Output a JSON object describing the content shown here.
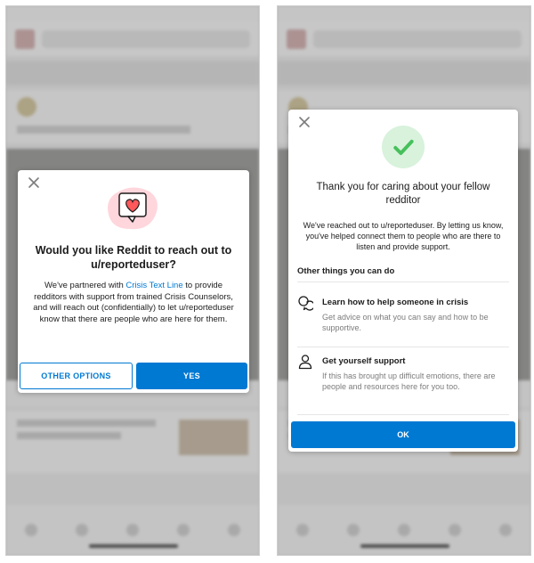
{
  "left_modal": {
    "title": "Would you like Reddit to reach out to u/reporteduser?",
    "body_pre": "We've partnered with ",
    "link_text": "Crisis Text Line",
    "body_post": " to provide redditors with support from trained Crisis Counselors, and will reach out (confidentially) to let u/reporteduser know that there are people who are here for them.",
    "other_options_label": "OTHER OPTIONS",
    "yes_label": "YES"
  },
  "right_modal": {
    "title": "Thank you for caring about your fellow redditor",
    "body": "We've reached out to u/reporteduser. By letting us know, you've helped connect them to people who are there to listen and provide support.",
    "section_heading": "Other things you can do",
    "items": [
      {
        "title": "Learn how to help someone in crisis",
        "desc": "Get advice on what you can say and how to be supportive.",
        "icon": "chat-bubbles-icon"
      },
      {
        "title": "Get yourself support",
        "desc": "If this has brought up difficult emotions, there are people and resources here for you too.",
        "icon": "person-icon"
      }
    ],
    "ok_label": "OK"
  },
  "colors": {
    "accent": "#0079d3",
    "check_bg": "#d8f2dc",
    "check": "#46c05b",
    "heart": "#ff585b"
  }
}
